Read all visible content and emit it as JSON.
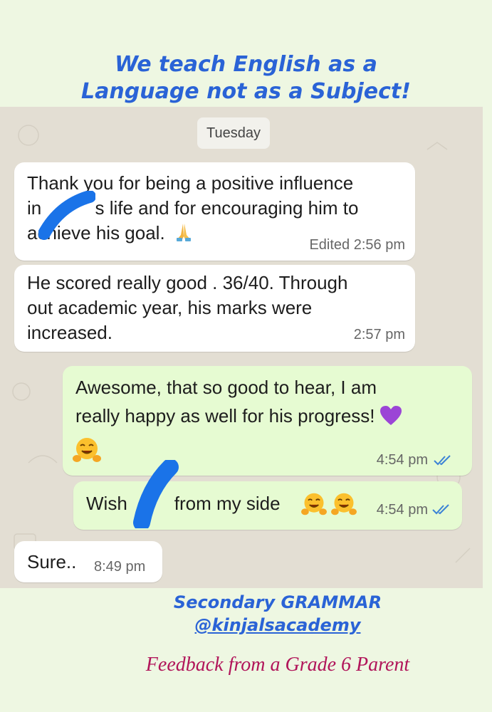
{
  "headline": {
    "line1": "We teach English as a",
    "line2": "Language not as a Subject!"
  },
  "chat": {
    "date_chip": "Tuesday",
    "messages": [
      {
        "direction": "incoming",
        "lines": [
          "Thank you for being a positive influence",
          "in [redacted]'s life and for encouraging him to",
          "achieve his goal."
        ],
        "line1": "Thank you for being a positive influence",
        "line2a": "in ",
        "line2b": "s life and for encouraging him to",
        "line3": "achieve his goal.",
        "emoji": "folded-hands",
        "time": "Edited 2:56 pm"
      },
      {
        "direction": "incoming",
        "text": "He scored really good . 36/40.  Through\nout academic year, his marks were\nincreased.",
        "time": "2:57 pm"
      },
      {
        "direction": "outgoing",
        "line1": "Awesome, that so good to hear, I am",
        "line2": "really happy as well for his progress!",
        "emojis": [
          "purple-heart",
          "hugging-face"
        ],
        "time": "4:54 pm",
        "status": "read"
      },
      {
        "direction": "outgoing",
        "text_a": "Wish",
        "text_b": "from my side",
        "emojis": [
          "hugging-face",
          "hugging-face"
        ],
        "time": "4:54 pm",
        "status": "read"
      },
      {
        "direction": "incoming",
        "text": "Sure..",
        "time": "8:49 pm"
      }
    ]
  },
  "footer": {
    "line1": "Secondary GRAMMAR",
    "line2": "@kinjalsacademy",
    "feedback": "Feedback from a Grade 6 Parent"
  },
  "colors": {
    "headline": "#2a63d6",
    "chat_background": "#e3ded3",
    "incoming_bubble": "#ffffff",
    "outgoing_bubble": "#e6fbd2",
    "read_ticks": "#3b82d6",
    "redaction": "#1a73e8",
    "feedback_text": "#b1155a",
    "page_background": "#eef7e2"
  }
}
